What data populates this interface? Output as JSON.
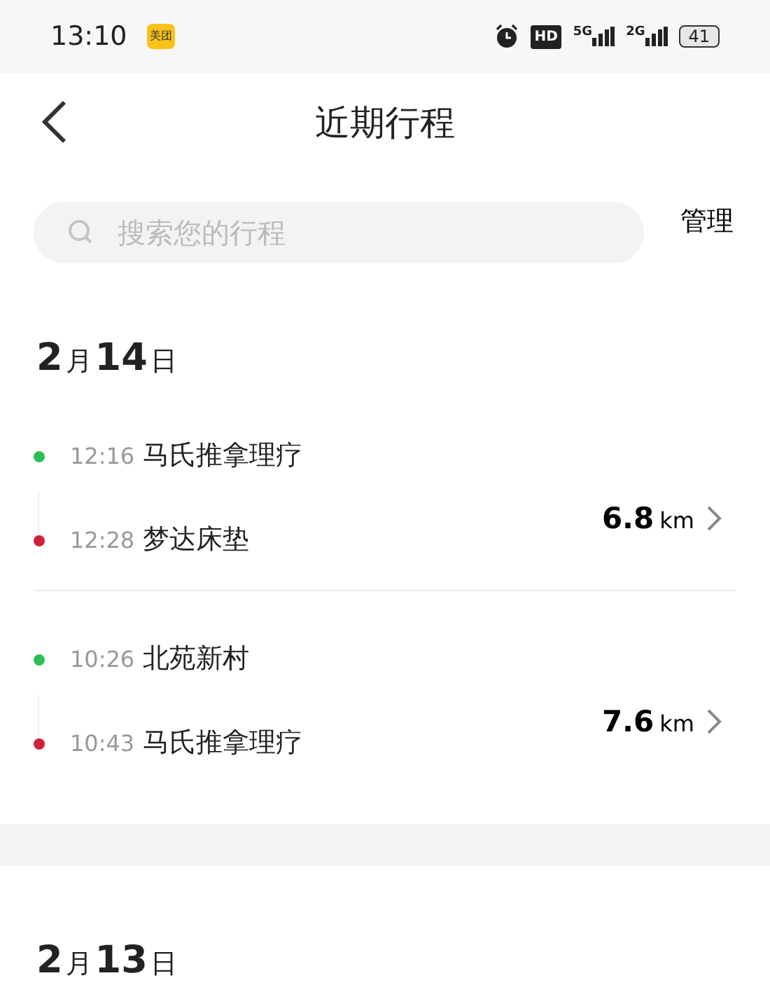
{
  "status_bar": {
    "time": "13:10",
    "app_badge": "美团",
    "battery": "41",
    "network_1": "5G",
    "network_2": "2G",
    "hd": "HD"
  },
  "header": {
    "title": "近期行程"
  },
  "search": {
    "placeholder": "搜索您的行程",
    "action": "管理"
  },
  "days": [
    {
      "month": "2",
      "month_unit": "月",
      "day": "14",
      "day_unit": "日",
      "trips": [
        {
          "stops": [
            {
              "time": "12:16",
              "place": "马氏推拿理疗",
              "color": "#2dbf55"
            },
            {
              "time": "12:28",
              "place": "梦达床垫",
              "color": "#d0203a"
            }
          ],
          "distance": "6.8",
          "unit": "km"
        },
        {
          "stops": [
            {
              "time": "10:26",
              "place": "北苑新村",
              "color": "#2dbf55"
            },
            {
              "time": "10:43",
              "place": "马氏推拿理疗",
              "color": "#d0203a"
            }
          ],
          "distance": "7.6",
          "unit": "km"
        }
      ]
    },
    {
      "month": "2",
      "month_unit": "月",
      "day": "13",
      "day_unit": "日"
    }
  ]
}
